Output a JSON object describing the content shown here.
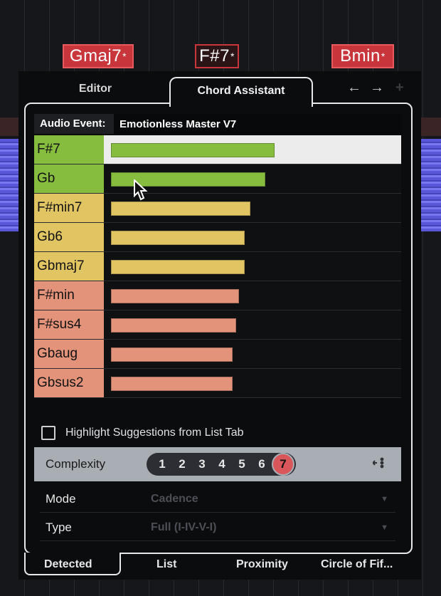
{
  "arrange": {
    "chord_events": [
      {
        "name": "Gmaj7",
        "suffix": "*"
      },
      {
        "name": "F#7",
        "suffix": "*"
      },
      {
        "name": "Bmin",
        "suffix": "*"
      }
    ]
  },
  "panel": {
    "tabs": [
      {
        "label": "Editor"
      },
      {
        "label": "Chord Assistant"
      }
    ],
    "nav": {
      "back": "←",
      "forward": "→",
      "add": "+"
    },
    "audio_event": {
      "label": "Audio Event:",
      "value": "Emotionless Master V7"
    },
    "suggestions": [
      {
        "name": "F#7",
        "score": 0.55,
        "color": "#86bd3f",
        "bar_color": "#86bd3f",
        "selected": true
      },
      {
        "name": "Gb",
        "score": 0.52,
        "color": "#86bd3f",
        "bar_color": "#86bd3f",
        "selected": false
      },
      {
        "name": "F#min7",
        "score": 0.47,
        "color": "#e2c563",
        "bar_color": "#e2c563",
        "selected": false
      },
      {
        "name": "Gb6",
        "score": 0.45,
        "color": "#e2c563",
        "bar_color": "#e2c563",
        "selected": false
      },
      {
        "name": "Gbmaj7",
        "score": 0.45,
        "color": "#e2c563",
        "bar_color": "#e2c563",
        "selected": false
      },
      {
        "name": "F#min",
        "score": 0.43,
        "color": "#e3937a",
        "bar_color": "#e3937a",
        "selected": false
      },
      {
        "name": "F#sus4",
        "score": 0.42,
        "color": "#e3937a",
        "bar_color": "#e3937a",
        "selected": false
      },
      {
        "name": "Gbaug",
        "score": 0.41,
        "color": "#e3937a",
        "bar_color": "#e3937a",
        "selected": false
      },
      {
        "name": "Gbsus2",
        "score": 0.41,
        "color": "#e3937a",
        "bar_color": "#e3937a",
        "selected": false
      }
    ],
    "highlight": {
      "label": "Highlight Suggestions from List Tab",
      "checked": false
    },
    "complexity": {
      "label": "Complexity",
      "levels": [
        "1",
        "2",
        "3",
        "4",
        "5",
        "6",
        "7"
      ],
      "active": "7"
    },
    "mode": {
      "label": "Mode",
      "value": "Cadence"
    },
    "type": {
      "label": "Type",
      "value": "Full (I-IV-V-I)"
    },
    "bottom_tabs": [
      {
        "label": "Detected"
      },
      {
        "label": "List"
      },
      {
        "label": "Proximity"
      },
      {
        "label": "Circle of Fif..."
      }
    ]
  }
}
